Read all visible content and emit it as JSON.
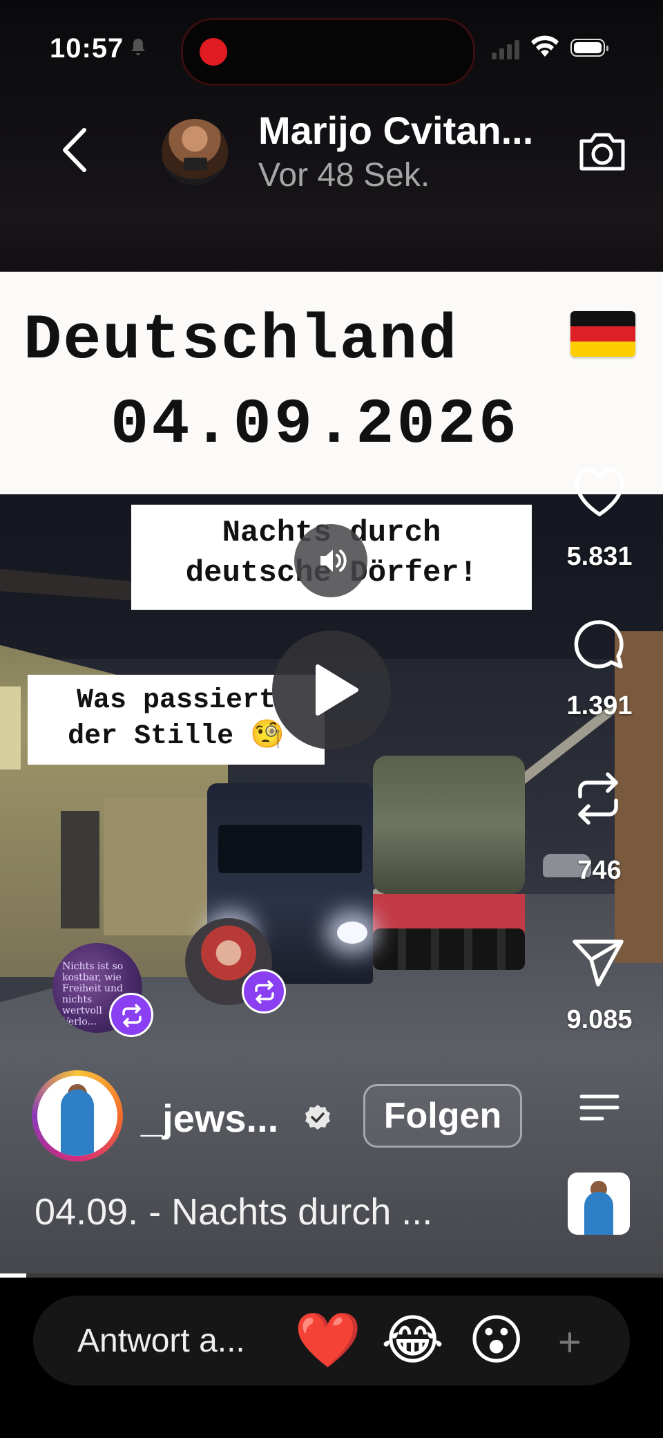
{
  "status_bar": {
    "time": "10:57"
  },
  "header": {
    "name": "Marijo Cvitan...",
    "time_ago": "Vor 48 Sek."
  },
  "title_card": {
    "line1": "Deutschland",
    "line2": "04.09.2026"
  },
  "captions": {
    "caption1_line1": "Nachts durch",
    "caption1_line2": "deutsche Dörfer!",
    "caption2_line1": "Was passiert",
    "caption2_line2": "der Stille"
  },
  "caption_emoji": "🧐",
  "stats": {
    "likes": "5.831",
    "comments": "1.391",
    "reposts": "746",
    "shares": "9.085"
  },
  "post": {
    "username": "_jews...",
    "follow_label": "Folgen",
    "description": "04.09. - Nachts durch ..."
  },
  "reply": {
    "placeholder": "Antwort a...",
    "emoji_heart": "❤️",
    "emoji_laugh": "😂",
    "emoji_wow": "😮",
    "plus": "+"
  },
  "repost_avatar1_text": "Nichts ist so kostbar, wie Freiheit und nichts wertvoll Verlo...",
  "colors": {
    "repost_badge": "#8a3ff2",
    "record_dot": "#e01b22"
  },
  "progress": {
    "fraction": 0.04
  },
  "icons": [
    "back-arrow-icon",
    "camera-icon",
    "heart-icon",
    "comment-icon",
    "repost-icon",
    "send-icon",
    "menu-icon",
    "volume-icon",
    "play-icon",
    "verified-icon",
    "wifi-icon",
    "battery-icon",
    "signal-icon",
    "bell-icon"
  ]
}
